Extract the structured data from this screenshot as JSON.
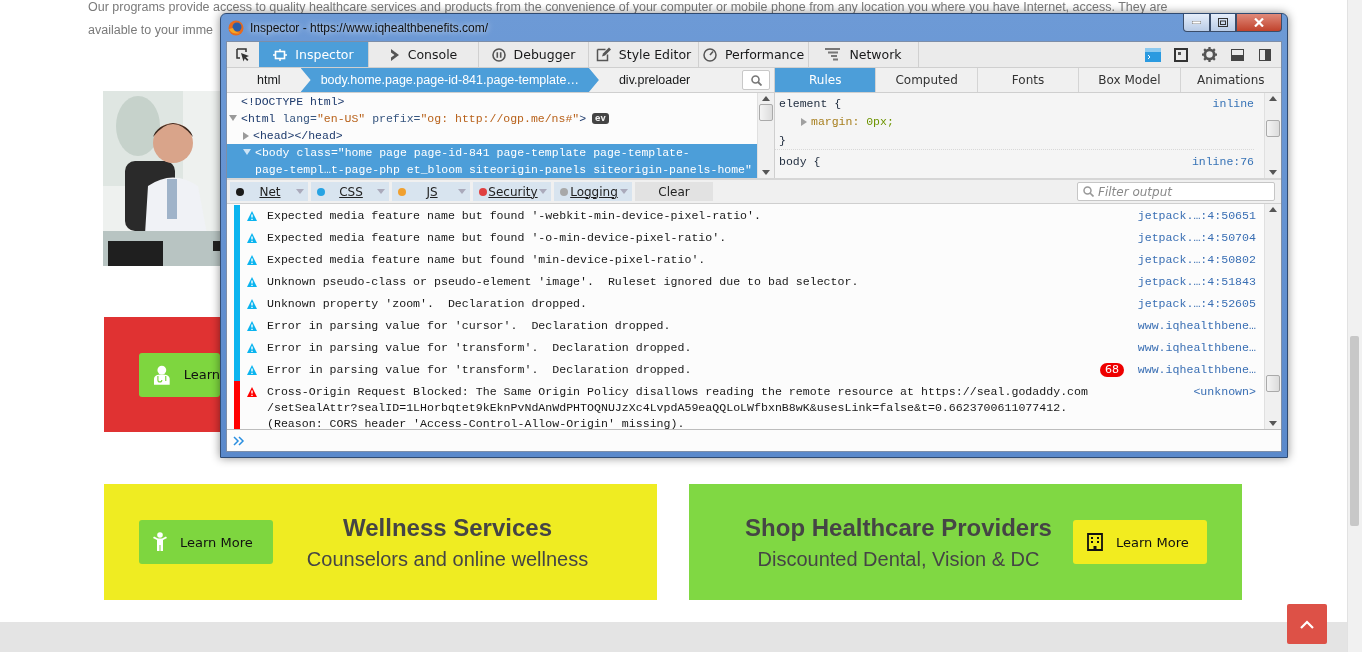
{
  "page": {
    "intro_lines": [
      "Our programs provide access to quality healthcare services and products from the convenience of your computer or mobile phone from any location you where you have Internet, access. They are",
      "available to your imme"
    ],
    "photo": {
      "kind": "picture"
    },
    "feature_card": {
      "color": "#e03232",
      "button": {
        "label": "Learn",
        "color": "#7ed63f"
      }
    },
    "cards": [
      {
        "kind": "leading-button",
        "color": "#efec22",
        "title": "Wellness Services",
        "subtitle": "Counselors and online wellness",
        "button": {
          "label": "Learn More",
          "color": "#7ed63f"
        }
      },
      {
        "kind": "trailing-button",
        "color": "#80d843",
        "title": "Shop Healthcare Providers",
        "subtitle": "Discounted Dental, Vision & DC",
        "button": {
          "label": "Learn More",
          "color": "#f2ec1f"
        }
      }
    ]
  },
  "devtools": {
    "title": "Inspector - https://www.iqhealthbenefits.com/",
    "tabs": [
      {
        "label": "Inspector",
        "selected": true
      },
      {
        "label": "Console",
        "selected": false
      },
      {
        "label": "Debugger",
        "selected": false
      },
      {
        "label": "Style Editor",
        "selected": false
      },
      {
        "label": "Performance",
        "selected": false
      },
      {
        "label": "Network",
        "selected": false
      }
    ],
    "breadcrumbs": [
      {
        "label": "html",
        "selected": false
      },
      {
        "label": "body.home.page.page-id-841.page-template…",
        "selected": true
      },
      {
        "label": "div.preloader",
        "selected": false
      }
    ],
    "sidebar_tabs": [
      {
        "label": "Rules",
        "selected": true
      },
      {
        "label": "Computed",
        "selected": false
      },
      {
        "label": "Fonts",
        "selected": false
      },
      {
        "label": "Box Model",
        "selected": false
      },
      {
        "label": "Animations",
        "selected": false
      }
    ],
    "markup": [
      {
        "parts": [
          {
            "kind": "tag",
            "text": "<!DOCTYPE html>"
          }
        ]
      },
      {
        "parts": [
          {
            "kind": "tag",
            "text": "<html"
          },
          {
            "kind": "attr",
            "text": " lang="
          },
          {
            "kind": "value",
            "text": "\"en-US\""
          },
          {
            "kind": "attr",
            "text": " prefix="
          },
          {
            "kind": "value",
            "text": "\"og: http://ogp.me/ns#\""
          },
          {
            "kind": "tag",
            "text": ">"
          }
        ],
        "badge": "ev",
        "expanded": true,
        "selected": false,
        "children": [
          {
            "parts": [
              {
                "kind": "tag",
                "text": "<head></head>"
              }
            ],
            "expanded": false,
            "selected": false
          },
          {
            "lines": [
              "<body class=\"home page page-id-841 page-template page-template-",
              "page-templ…t-page-php et_bloom siteorigin-panels siteorigin-panels-home\""
            ],
            "expanded": true,
            "selected": true
          }
        ]
      }
    ],
    "rules": [
      {
        "selector": "element {",
        "source": "inline",
        "declarations": [
          {
            "property": "margin:",
            "value": "0px;"
          }
        ],
        "close": "}"
      },
      {
        "selector": "body {",
        "source": "inline:76"
      }
    ],
    "filters": [
      {
        "label": "Net",
        "color": "#1a1a1a"
      },
      {
        "label": "CSS",
        "color": "#27a3e3"
      },
      {
        "label": "JS",
        "color": "#f0a030"
      },
      {
        "label": "Security",
        "color": "#e04040"
      },
      {
        "label": "Logging",
        "color": "#a8a8a8"
      }
    ],
    "clear_label": "Clear",
    "filter_placeholder": "Filter output",
    "messages": [
      {
        "kind": "warning",
        "lines": [
          "Expected media feature name but found '-webkit-min-device-pixel-ratio'."
        ],
        "source": "jetpack.…:4:50651"
      },
      {
        "kind": "warning",
        "lines": [
          "Expected media feature name but found '-o-min-device-pixel-ratio'."
        ],
        "source": "jetpack.…:4:50704"
      },
      {
        "kind": "warning",
        "lines": [
          "Expected media feature name but found 'min-device-pixel-ratio'."
        ],
        "source": "jetpack.…:4:50802"
      },
      {
        "kind": "warning",
        "lines": [
          "Unknown pseudo-class or pseudo-element 'image'.  Ruleset ignored due to bad selector."
        ],
        "source": "jetpack.…:4:51843"
      },
      {
        "kind": "warning",
        "lines": [
          "Unknown property 'zoom'.  Declaration dropped."
        ],
        "source": "jetpack.…:4:52605"
      },
      {
        "kind": "warning",
        "lines": [
          "Error in parsing value for 'cursor'.  Declaration dropped."
        ],
        "source": "www.iqhealthbene…"
      },
      {
        "kind": "warning",
        "lines": [
          "Error in parsing value for 'transform'.  Declaration dropped."
        ],
        "source": "www.iqhealthbene…"
      },
      {
        "kind": "warning",
        "lines": [
          "Error in parsing value for 'transform'.  Declaration dropped."
        ],
        "source": "www.iqhealthbene…",
        "repeat": "68"
      },
      {
        "kind": "error",
        "lines": [
          "Cross-Origin Request Blocked: The Same Origin Policy disallows reading the remote resource at https://seal.godaddy.com",
          "/setSealAttr?sealID=1LHorbqtet9kEknPvNdAnWdPHTOQNUJzXc4LvpdA59eaQQLoLWfbxnB8wK&usesLink=false&t=0.6623700611077412.",
          "(Reason: CORS header 'Access-Control-Allow-Origin' missing)."
        ],
        "source": "<unknown>"
      }
    ]
  }
}
